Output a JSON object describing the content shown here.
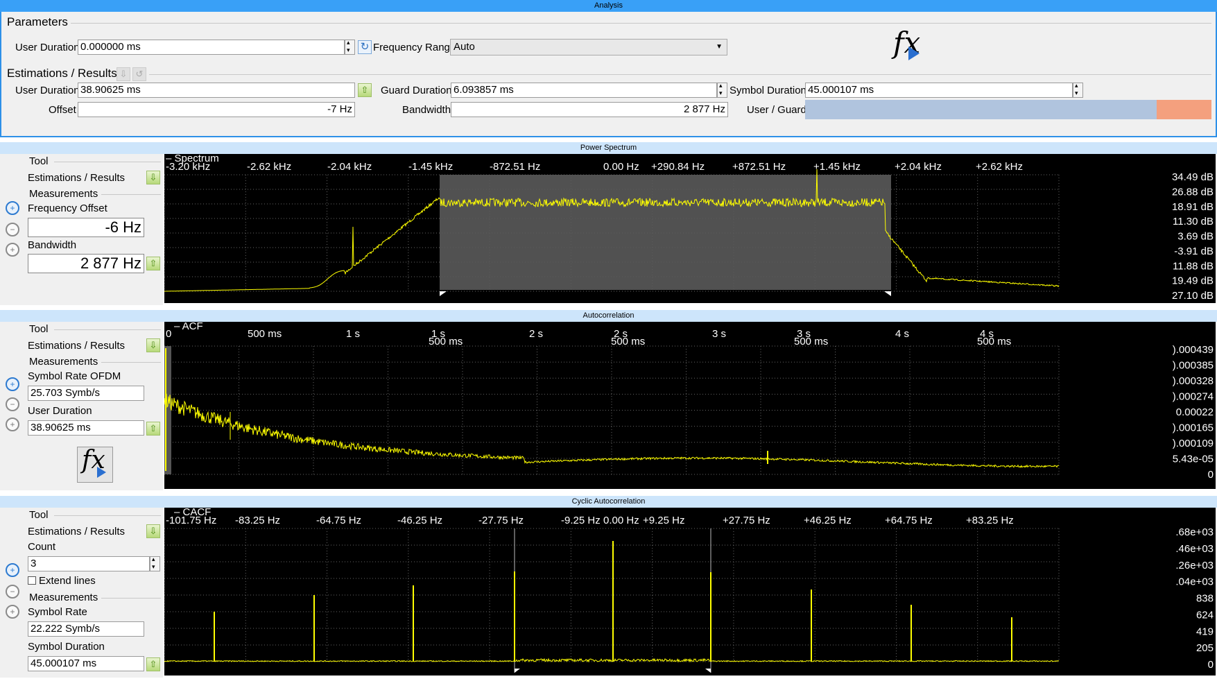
{
  "analysis": {
    "window_title": "Analysis",
    "parameters_title": "Parameters",
    "user_duration_label": "User Duration",
    "user_duration_value": "0.000000 ms",
    "frequency_range_label": "Frequency Range",
    "frequency_range_value": "Auto",
    "estimations_title": "Estimations / Results",
    "est_user_duration_label": "User Duration",
    "est_user_duration_value": "38.90625 ms",
    "guard_duration_label": "Guard Duration",
    "guard_duration_value": "6.093857 ms",
    "symbol_duration_label": "Symbol Duration",
    "symbol_duration_value": "45.000107 ms",
    "offset_label": "Offset",
    "offset_value": "-7 Hz",
    "bandwidth_label": "Bandwidth",
    "bandwidth_value": "2 877 Hz",
    "user_guard_label": "User / Guard",
    "user_guard_ratio": 0.865,
    "fx_icon": "fx-run-icon",
    "colors": {
      "user": "#b0c4de",
      "guard": "#f4a07e",
      "accent": "#39a0f7",
      "trace": "#ffff00"
    }
  },
  "power_spectrum": {
    "title": "Power Spectrum",
    "trace_label": "Spectrum",
    "tool_label": "Tool",
    "estimations_label": "Estimations / Results",
    "measurements_label": "Measurements",
    "freq_offset_label": "Frequency Offset",
    "freq_offset_value": "-6 Hz",
    "bandwidth_label": "Bandwidth",
    "bandwidth_value": "2 877 Hz",
    "x_ticks": [
      "-3.20 kHz",
      "-2.62 kHz",
      "-2.04 kHz",
      "-1.45 kHz",
      "-872.51 Hz",
      "0.00 Hz",
      "+290.84 Hz",
      "+872.51 Hz",
      "+1.45 kHz",
      "+2.04 kHz",
      "+2.62 kHz"
    ],
    "y_ticks": [
      "34.49 dB",
      "26.88 dB",
      "18.91 dB",
      "11.30 dB",
      "3.69 dB",
      "-3.91 dB",
      "11.88 dB",
      "19.49 dB",
      "27.10 dB"
    ]
  },
  "autocorrelation": {
    "title": "Autocorrelation",
    "trace_label": "ACF",
    "tool_label": "Tool",
    "estimations_label": "Estimations / Results",
    "measurements_label": "Measurements",
    "symbol_rate_label": "Symbol Rate OFDM",
    "symbol_rate_value": "25.703 Symb/s",
    "user_duration_label": "User Duration",
    "user_duration_value": "38.90625 ms",
    "x_ticks_top": [
      "0",
      "500 ms",
      "1 s",
      "1 s",
      "2 s",
      "2 s",
      "3 s",
      "3 s",
      "4 s",
      "4 s"
    ],
    "x_ticks_sub": [
      "500 ms",
      "500 ms",
      "500 ms",
      "500 ms"
    ],
    "y_ticks": [
      ").000439",
      ").000385",
      ").000328",
      ").000274",
      "0.00022",
      ").000165",
      ").000109",
      "5.43e-05",
      "0"
    ]
  },
  "cyclic_autocorrelation": {
    "title": "Cyclic Autocorrelation",
    "trace_label": "CACF",
    "tool_label": "Tool",
    "estimations_label": "Estimations / Results",
    "count_label": "Count",
    "count_value": "3",
    "extend_lines_label": "Extend lines",
    "measurements_label": "Measurements",
    "symbol_rate_label": "Symbol Rate",
    "symbol_rate_value": "22.222 Symb/s",
    "symbol_duration_label": "Symbol Duration",
    "symbol_duration_value": "45.000107 ms",
    "x_ticks": [
      "-101.75 Hz",
      "-83.25 Hz",
      "-64.75 Hz",
      "-46.25 Hz",
      "-27.75 Hz",
      "-9.25 Hz",
      "0.00 Hz",
      "+9.25 Hz",
      "+27.75 Hz",
      "+46.25 Hz",
      "+64.75 Hz",
      "+83.25 Hz"
    ],
    "y_ticks": [
      ".68e+03",
      ".46e+03",
      ".26e+03",
      ".04e+03",
      "838",
      "624",
      "419",
      "205",
      "0"
    ]
  }
}
